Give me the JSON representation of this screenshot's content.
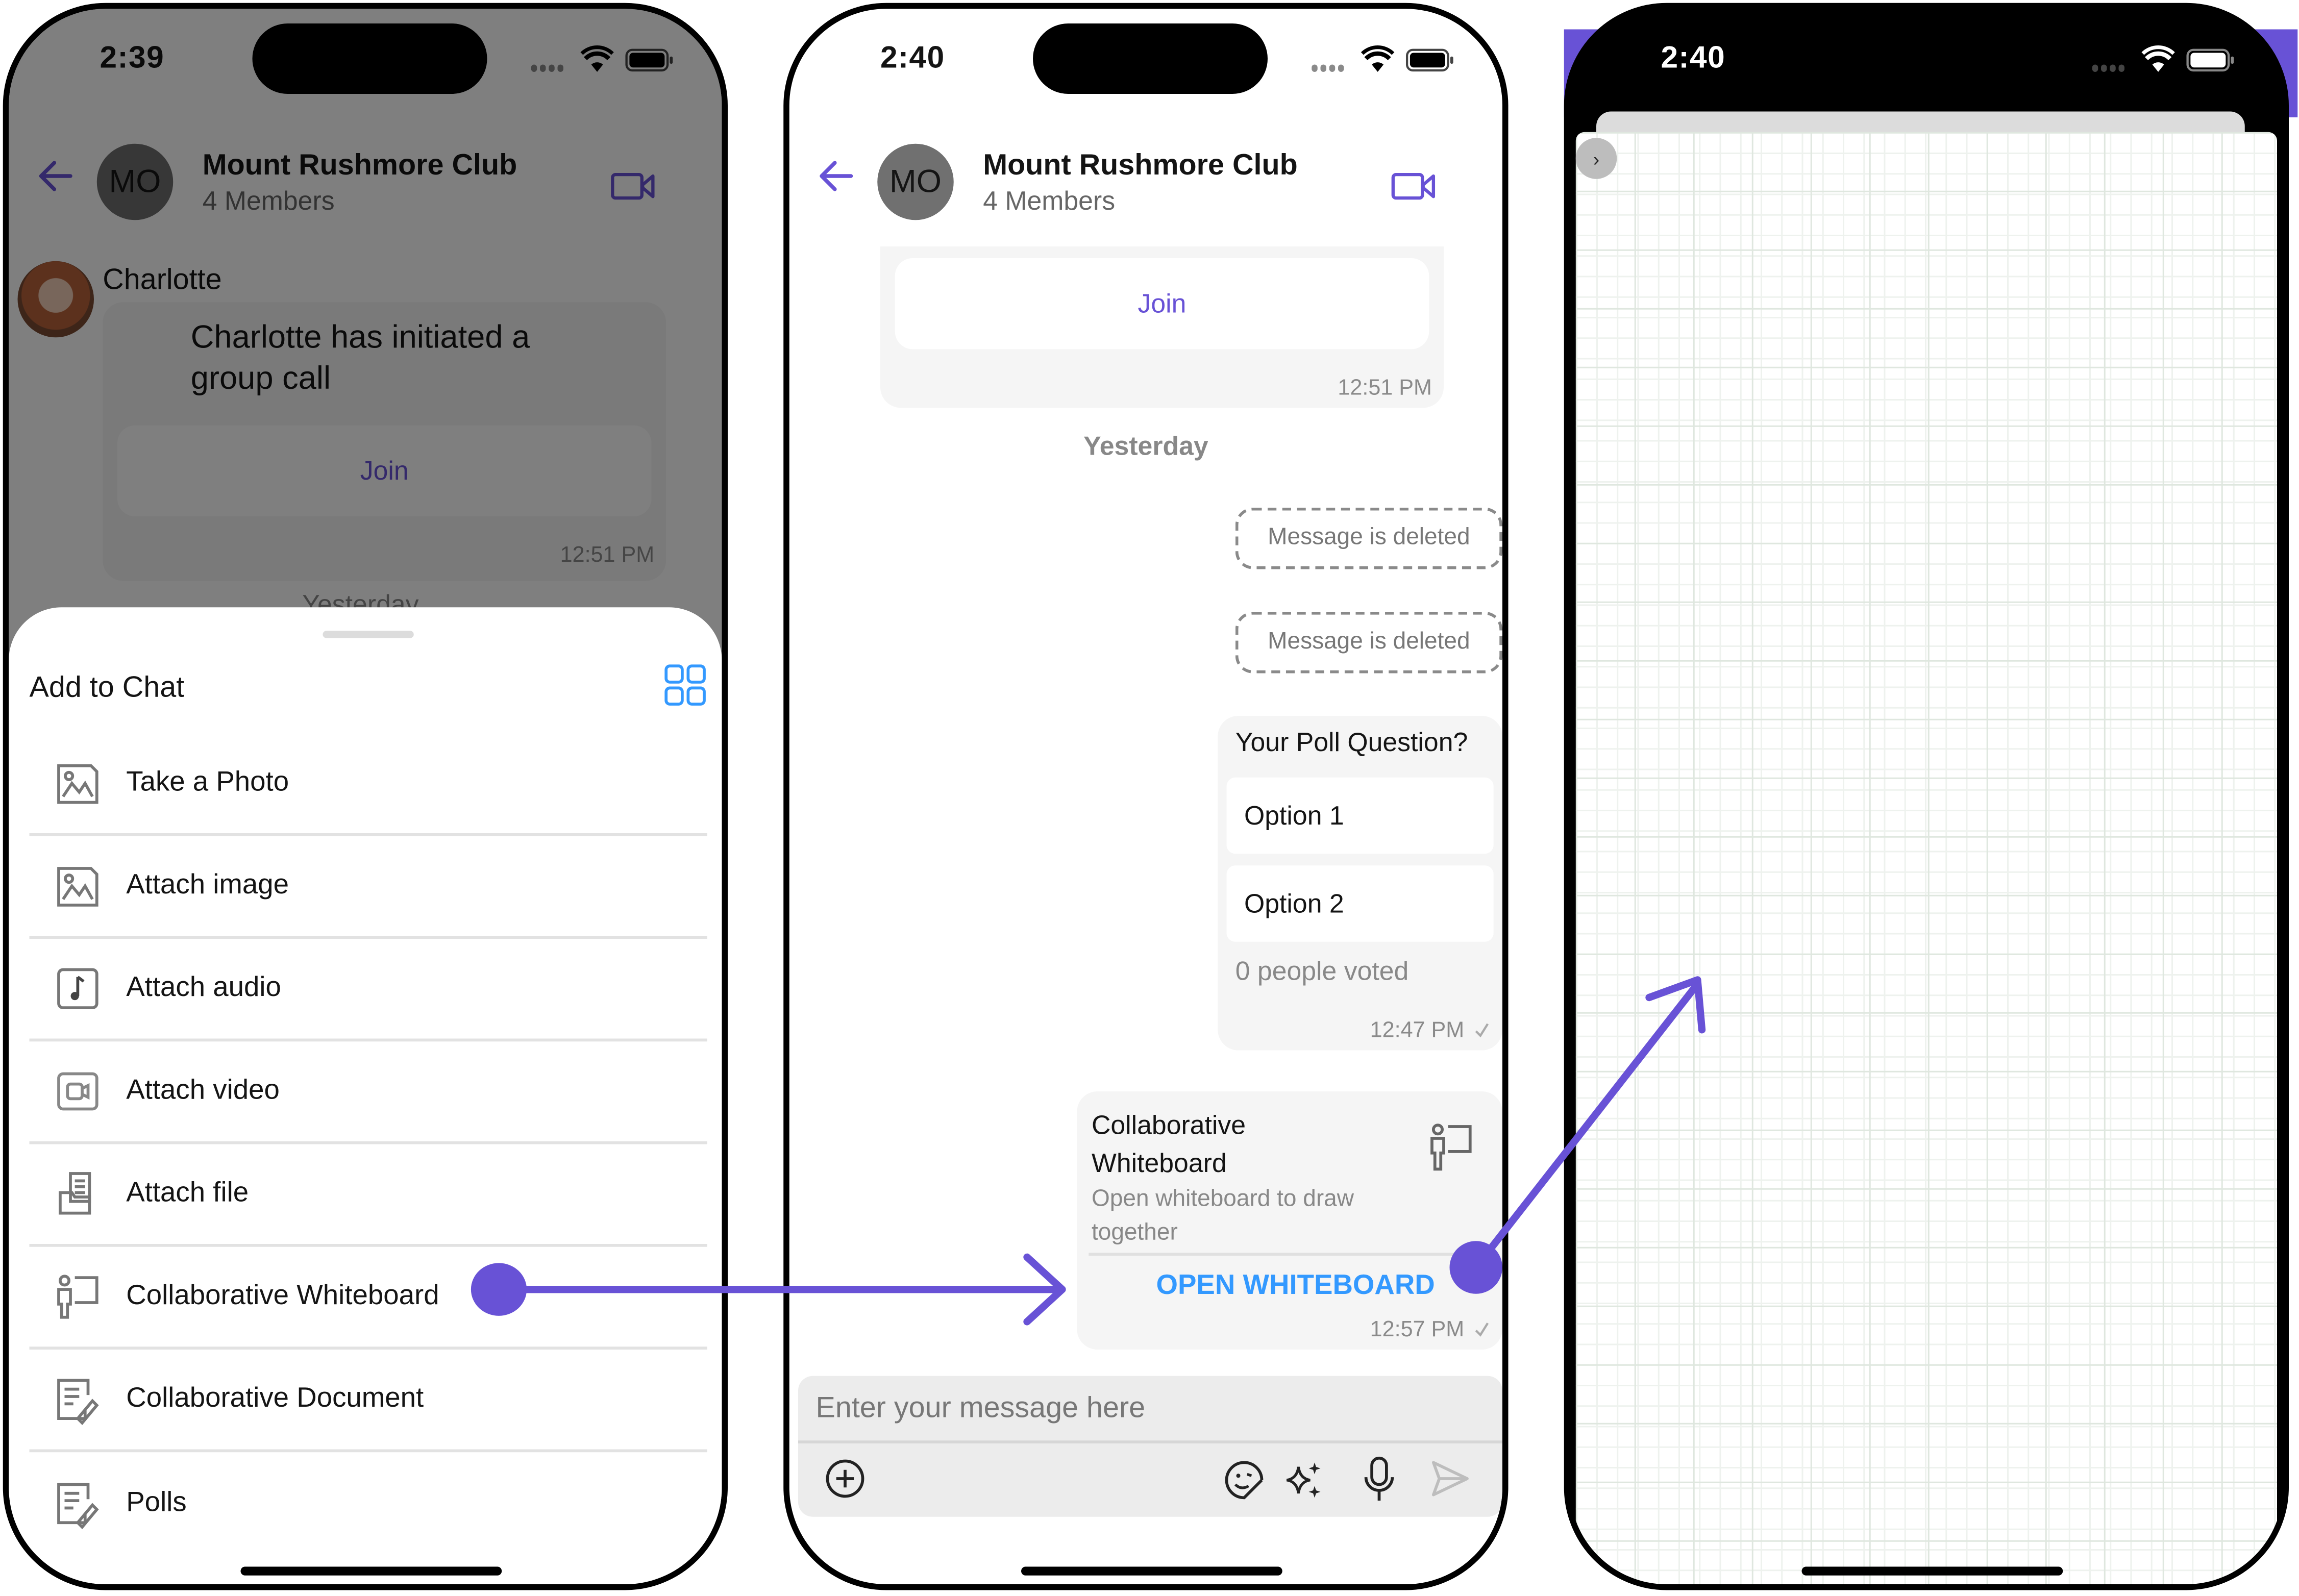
{
  "accent_color": "#6852d6",
  "link_color": "#3399ff",
  "phone1": {
    "status_time": "2:39",
    "header": {
      "title": "Mount Rushmore Club",
      "subtitle": "4 Members",
      "avatar_initials": "MO"
    },
    "message": {
      "sender": "Charlotte",
      "text": "Charlotte has initiated a group call",
      "join_label": "Join",
      "time": "12:51 PM"
    },
    "date_separator": "Yesterday",
    "sheet": {
      "title": "Add to Chat",
      "options": [
        {
          "label": "Take a Photo",
          "icon": "photo-icon"
        },
        {
          "label": "Attach image",
          "icon": "image-icon"
        },
        {
          "label": "Attach audio",
          "icon": "audio-icon"
        },
        {
          "label": "Attach video",
          "icon": "video-icon"
        },
        {
          "label": "Attach file",
          "icon": "file-icon"
        },
        {
          "label": "Collaborative Whiteboard",
          "icon": "whiteboard-icon"
        },
        {
          "label": "Collaborative Document",
          "icon": "document-icon"
        },
        {
          "label": "Polls",
          "icon": "polls-icon"
        }
      ]
    }
  },
  "phone2": {
    "status_time": "2:40",
    "header": {
      "title": "Mount Rushmore Club",
      "subtitle": "4 Members",
      "avatar_initials": "MO"
    },
    "call_message": {
      "join_label": "Join",
      "time": "12:51 PM"
    },
    "date_separator": "Yesterday",
    "deleted_messages": [
      "Message is deleted",
      "Message is deleted"
    ],
    "poll": {
      "question": "Your Poll Question?",
      "options": [
        "Option 1",
        "Option 2"
      ],
      "votes_text": "0 people voted",
      "time": "12:47 PM"
    },
    "whiteboard_message": {
      "title": "Collaborative Whiteboard",
      "description": "Open whiteboard to draw together",
      "action_label": "OPEN WHITEBOARD",
      "time": "12:57 PM"
    },
    "composer": {
      "placeholder": "Enter your message here"
    }
  },
  "phone3": {
    "status_time": "2:40"
  }
}
